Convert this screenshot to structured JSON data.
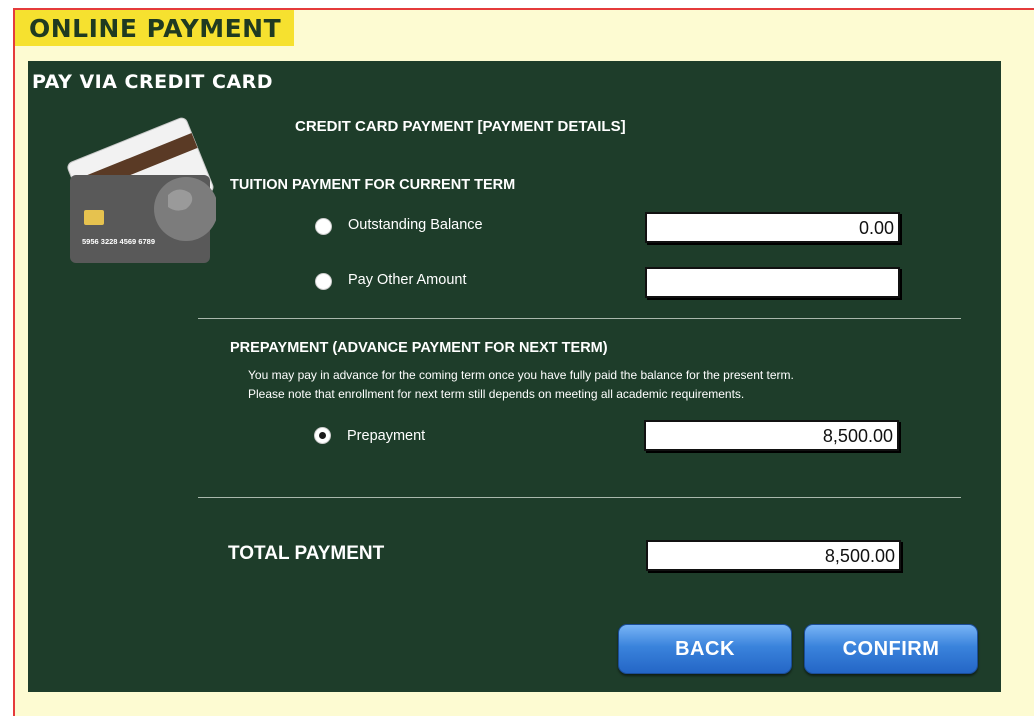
{
  "header": {
    "title": "ONLINE PAYMENT"
  },
  "panel": {
    "title": "PAY VIA CREDIT CARD",
    "details_heading": "CREDIT CARD PAYMENT [PAYMENT DETAILS]",
    "card_number": "5956 3228 4569 6789"
  },
  "tuition": {
    "heading": "TUITION PAYMENT FOR CURRENT TERM",
    "outstanding": {
      "label": "Outstanding Balance",
      "value": "0.00",
      "selected": false
    },
    "other": {
      "label": "Pay Other Amount",
      "value": "",
      "selected": false
    }
  },
  "prepayment": {
    "heading": "PREPAYMENT (ADVANCE PAYMENT FOR NEXT TERM)",
    "note_line1": "You may pay in advance for the coming term once you have fully paid the balance for the present term.",
    "note_line2": "Please note that enrollment for next term still depends on meeting all academic requirements.",
    "option": {
      "label": "Prepayment",
      "value": "8,500.00",
      "selected": true
    }
  },
  "total": {
    "label": "TOTAL PAYMENT",
    "value": "8,500.00"
  },
  "buttons": {
    "back": "BACK",
    "confirm": "CONFIRM"
  },
  "colors": {
    "panel_bg": "#1e3d2a",
    "header_tab": "#f6e12f",
    "frame_bg": "#fdfbd2",
    "frame_border": "#e53b3b",
    "button_blue": "#3a83dc"
  },
  "icons": {
    "card": "credit-card-icon"
  }
}
